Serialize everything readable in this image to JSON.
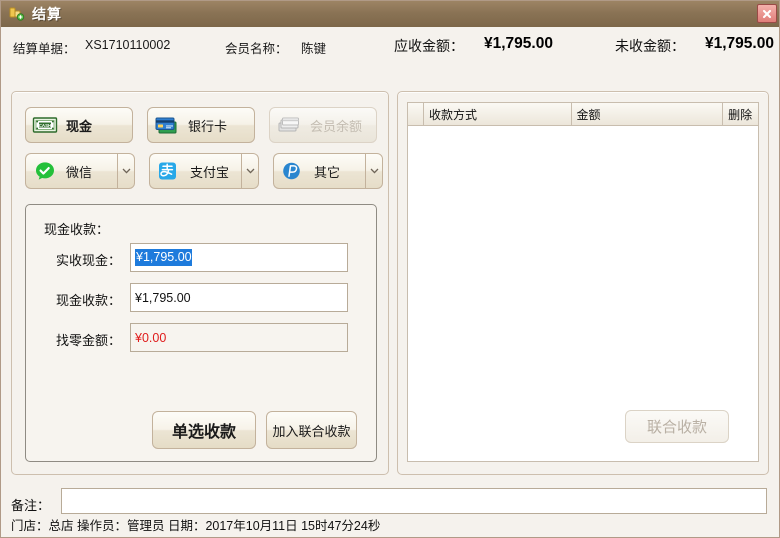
{
  "window": {
    "title": "结算",
    "icon": "settlement-icon",
    "close_label": "×"
  },
  "header": {
    "order_label": "结算单据：",
    "order_value": "XS1710110002",
    "member_label": "会员名称：",
    "member_value": "陈键",
    "receivable_label": "应收金额：",
    "receivable_value": "¥1,795.00",
    "unreceived_label": "未收金额：",
    "unreceived_value": "¥1,795.00"
  },
  "payment_methods": [
    {
      "id": "cash",
      "label": "现金",
      "icon": "cash-banknote-icon",
      "selected": true,
      "disabled": false,
      "has_dropdown": false
    },
    {
      "id": "bankcard",
      "label": "银行卡",
      "icon": "credit-card-icon",
      "selected": false,
      "disabled": false,
      "has_dropdown": false
    },
    {
      "id": "balance",
      "label": "会员余额",
      "icon": "member-card-icon",
      "selected": false,
      "disabled": true,
      "has_dropdown": false
    },
    {
      "id": "wechat",
      "label": "微信",
      "icon": "wechat-icon",
      "selected": false,
      "disabled": false,
      "has_dropdown": true
    },
    {
      "id": "alipay",
      "label": "支付宝",
      "icon": "alipay-icon",
      "selected": false,
      "disabled": false,
      "has_dropdown": true
    },
    {
      "id": "other",
      "label": "其它",
      "icon": "other-payment-icon",
      "selected": false,
      "disabled": false,
      "has_dropdown": true
    }
  ],
  "cash_form": {
    "title": "现金收款：",
    "fields": [
      {
        "label": "实收现金：",
        "value": "¥1,795.00",
        "selected": true,
        "readonly": false,
        "color": "#111111"
      },
      {
        "label": "现金收款：",
        "value": "¥1,795.00",
        "selected": false,
        "readonly": false,
        "color": "#111111"
      },
      {
        "label": "找零金额：",
        "value": "¥0.00",
        "selected": false,
        "readonly": true,
        "color": "#e01b1b"
      }
    ],
    "single_pay_button": "单选收款",
    "add_joint_button": "加入联合收款"
  },
  "payment_table": {
    "columns": [
      "",
      "收款方式",
      "金额",
      "删除"
    ],
    "rows": [],
    "joint_pay_button": "联合收款",
    "joint_pay_disabled": true
  },
  "remark": {
    "label": "备注：",
    "value": "",
    "placeholder": ""
  },
  "status": {
    "text": "门店：总店   操作员：管理员   日期：2017年10月11日 15时47分24秒"
  },
  "colors": {
    "titlebar": "#8a7355",
    "panel_bg": "#f5f2ed",
    "accent_selection": "#1e7bdc",
    "change_amount": "#e01b1b",
    "wechat_green": "#25c03a",
    "alipay_blue": "#28a8e8",
    "other_blue": "#2a86cf"
  }
}
